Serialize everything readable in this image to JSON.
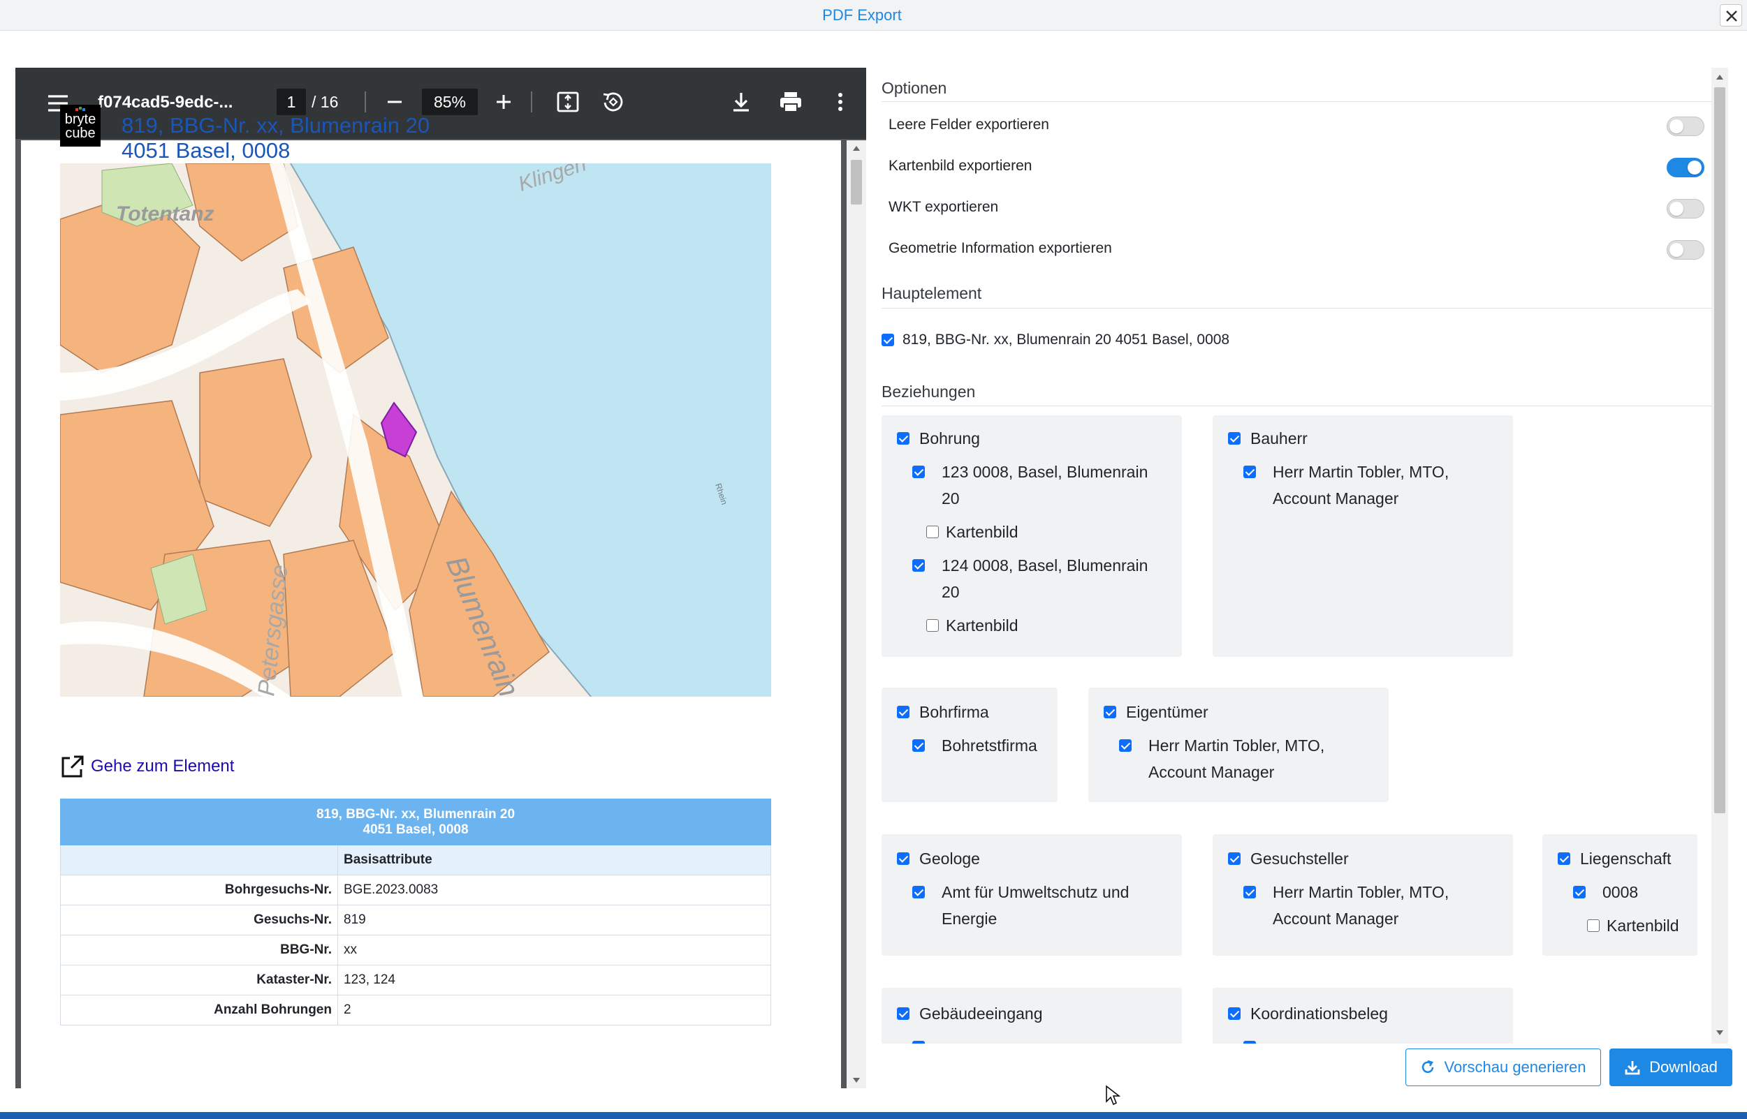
{
  "dialog": {
    "title": "PDF Export"
  },
  "pdf_viewer": {
    "filename": "f074cad5-9edc-...",
    "page_current": "1",
    "page_total": "/ 16",
    "zoom": "85%",
    "document": {
      "logo_text_1": "bryte",
      "logo_text_2": "cube",
      "title_line1": "819, BBG-Nr. xx, Blumenrain 20",
      "title_line2": "4051 Basel, 0008",
      "map_labels": {
        "totentanz": "Totentanz",
        "klingen": "Klingen",
        "rhein": "Rhein",
        "blumenrain": "Blumenrain",
        "petersgasse": "Petersgasse"
      },
      "goto_link": "Gehe zum Element",
      "table": {
        "header_line1": "819, BBG-Nr. xx, Blumenrain 20",
        "header_line2": "4051 Basel, 0008",
        "subheader": "Basisattribute",
        "rows": [
          {
            "label": "Bohrgesuchs-Nr.",
            "value": "BGE.2023.0083"
          },
          {
            "label": "Gesuchs-Nr.",
            "value": "819"
          },
          {
            "label": "BBG-Nr.",
            "value": "xx"
          },
          {
            "label": "Kataster-Nr.",
            "value": "123, 124"
          },
          {
            "label": "Anzahl Bohrungen",
            "value": "2"
          }
        ]
      }
    }
  },
  "options": {
    "title": "Optionen",
    "toggles": [
      {
        "label": "Leere Felder exportieren",
        "on": false
      },
      {
        "label": "Kartenbild exportieren",
        "on": true
      },
      {
        "label": "WKT exportieren",
        "on": false
      },
      {
        "label": "Geometrie Information exportieren",
        "on": false
      }
    ]
  },
  "hauptelement": {
    "title": "Hauptelement",
    "item": "819, BBG-Nr. xx, Blumenrain 20 4051 Basel, 0008"
  },
  "beziehungen": {
    "title": "Beziehungen",
    "bohrung": {
      "title": "Bohrung",
      "items": [
        {
          "line1": "123 0008, Basel, Blumenrain",
          "line2": "20",
          "kartenbild": "Kartenbild"
        },
        {
          "line1": "124 0008, Basel, Blumenrain",
          "line2": "20",
          "kartenbild": "Kartenbild"
        }
      ]
    },
    "bauherr": {
      "title": "Bauherr",
      "line1": "Herr Martin Tobler, MTO,",
      "line2": "Account Manager"
    },
    "bohrfirma": {
      "title": "Bohrfirma",
      "item": "Bohretstfirma"
    },
    "eigentuemer": {
      "title": "Eigentümer",
      "line1": "Herr Martin Tobler, MTO,",
      "line2": "Account Manager"
    },
    "geologe": {
      "title": "Geologe",
      "line1": "Amt für Umweltschutz und",
      "line2": "Energie"
    },
    "gesuchsteller": {
      "title": "Gesuchsteller",
      "line1": "Herr Martin Tobler, MTO,",
      "line2": "Account Manager"
    },
    "liegenschaft": {
      "title": "Liegenschaft",
      "item": "0008",
      "kartenbild": "Kartenbild"
    },
    "gebaeudeeingang": {
      "title": "Gebäudeeingang"
    },
    "koordinationsbeleg": {
      "title": "Koordinationsbeleg"
    }
  },
  "buttons": {
    "preview": "Vorschau generieren",
    "download": "Download"
  },
  "colors": {
    "accent": "#1e88e5",
    "checkbox": "#0d6efd",
    "toolbar": "#323639",
    "table_header": "#6cb4f0",
    "highlight_parcel": "#c83fd6"
  }
}
